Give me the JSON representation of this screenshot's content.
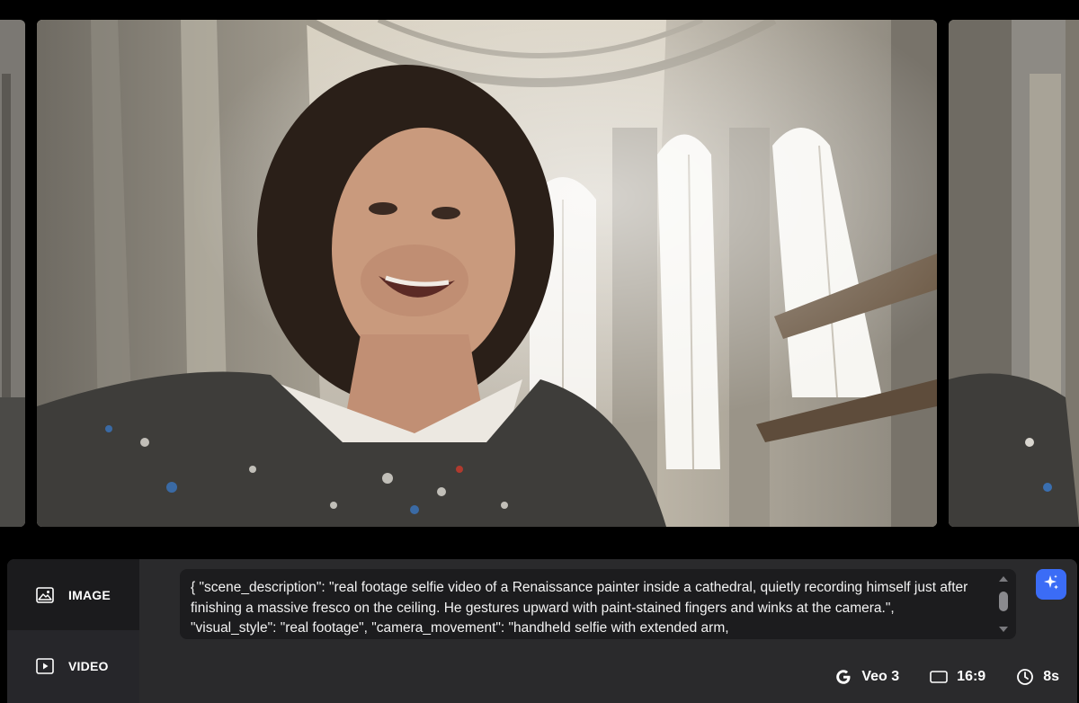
{
  "modes": [
    {
      "label": "IMAGE",
      "icon": "image-icon",
      "active": true
    },
    {
      "label": "VIDEO",
      "icon": "video-play-icon",
      "active": false
    }
  ],
  "prompt": {
    "text": "{ \"scene_description\": \"real footage selfie video of a Renaissance painter inside a cathedral, quietly recording himself just after finishing a massive fresco on the ceiling. He gestures upward with paint-stained fingers and winks at the camera.\", \"visual_style\": \"real footage\", \"camera_movement\": \"handheld selfie with extended arm,"
  },
  "settings": {
    "model": "Veo 3",
    "model_icon": "google-g-icon",
    "aspect_ratio": "16:9",
    "aspect_icon": "aspect-ratio-icon",
    "duration": "8s",
    "duration_icon": "clock-icon"
  },
  "colors": {
    "background": "#000000",
    "panel": "#2a2a2c",
    "prompt_box": "#1c1c1e",
    "accent": "#3b6cf6"
  }
}
